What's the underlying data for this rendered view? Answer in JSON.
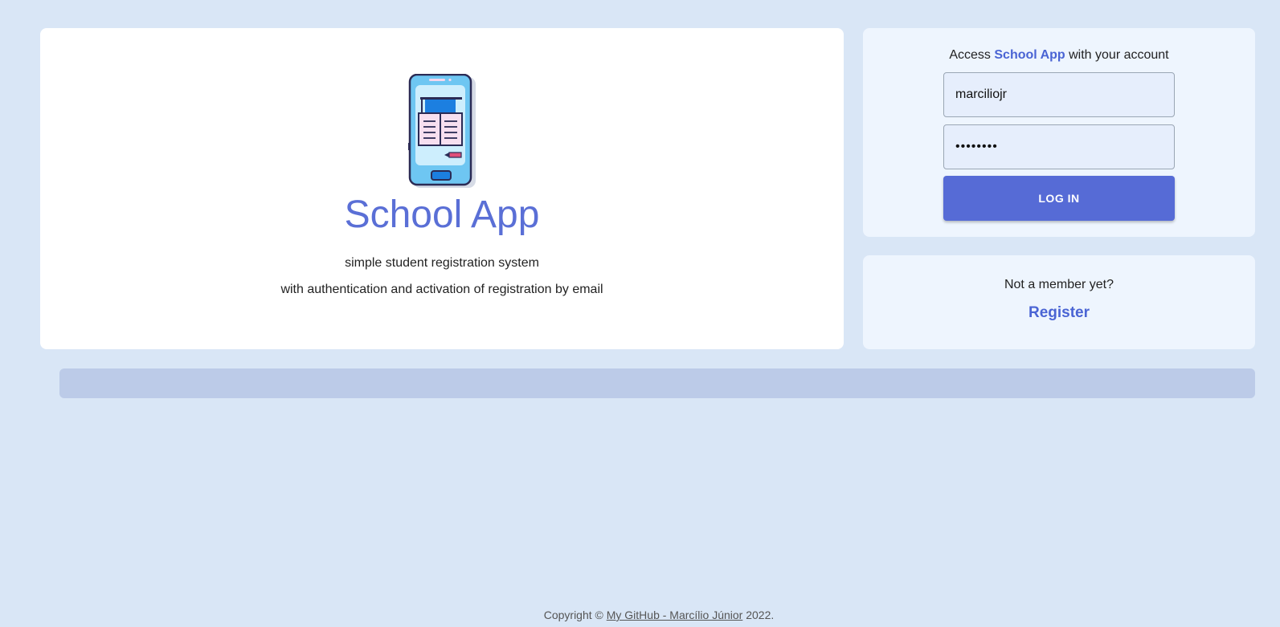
{
  "hero": {
    "title": "School App",
    "tagline_1": "simple student registration system",
    "tagline_2": "with authentication and activation of registration by email",
    "illustration_icon": "phone-education-icon"
  },
  "login": {
    "access_prefix": "Access ",
    "access_brand": "School App",
    "access_suffix": " with your account",
    "username_value": "marciliojr",
    "password_value": "••••••••",
    "button_label": "LOG IN"
  },
  "register": {
    "prompt": "Not a member yet?",
    "link_label": "Register"
  },
  "footer": {
    "prefix": "Copyright © ",
    "link_label": "My GitHub - Marcílio Júnior",
    "suffix": " 2022."
  },
  "colors": {
    "background": "#d9e6f6",
    "accent": "#566bd6",
    "brand_text": "#4a64d4",
    "banner": "#bccbe8"
  }
}
